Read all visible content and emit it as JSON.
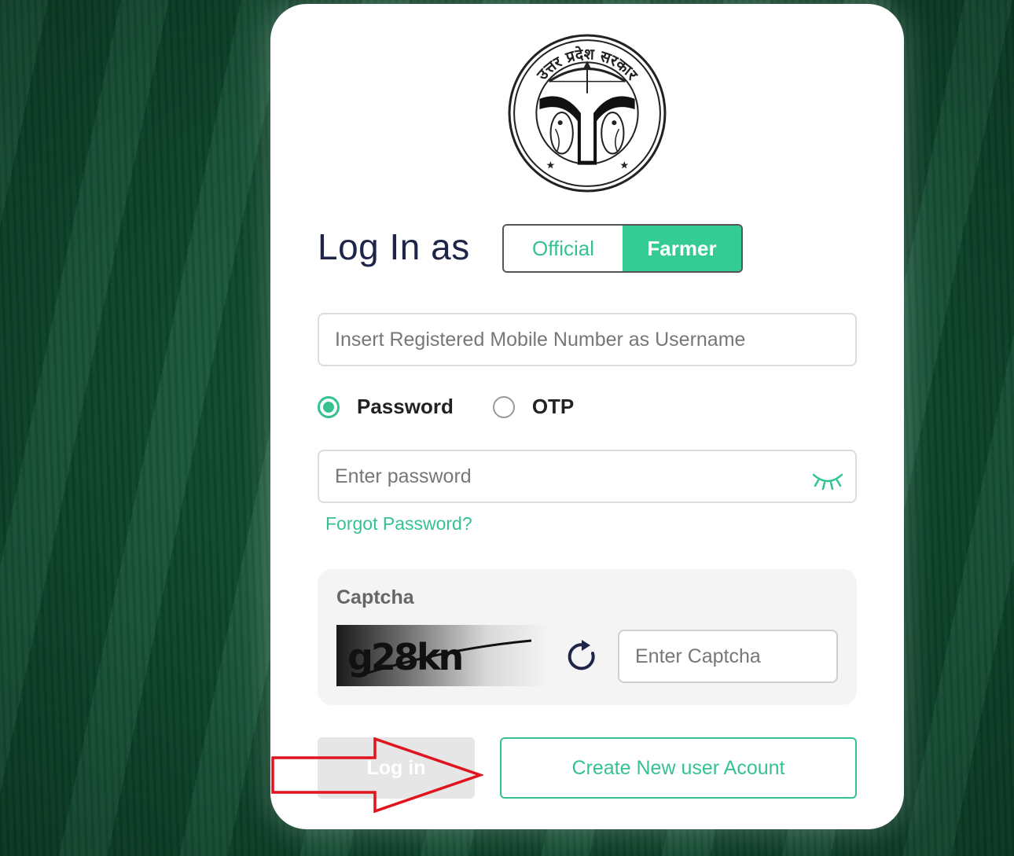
{
  "emblem": {
    "text": "उत्तर प्रदेश सरकार",
    "icon": "up-government-emblem"
  },
  "login": {
    "title": "Log In as",
    "roles": [
      {
        "label": "Official",
        "selected": false
      },
      {
        "label": "Farmer",
        "selected": true
      }
    ]
  },
  "username": {
    "placeholder": "Insert Registered Mobile Number as Username"
  },
  "auth_method": {
    "options": [
      {
        "label": "Password",
        "checked": true
      },
      {
        "label": "OTP",
        "checked": false
      }
    ]
  },
  "password": {
    "placeholder": "Enter password",
    "toggle_icon": "eye-closed-icon"
  },
  "forgot_password": "Forgot Password?",
  "captcha": {
    "title": "Captcha",
    "image_text": "g28kn",
    "refresh_icon": "refresh-icon",
    "placeholder": "Enter Captcha"
  },
  "buttons": {
    "login": "Log in",
    "create_account": "Create New user Acount"
  },
  "colors": {
    "accent": "#34c38f",
    "title": "#1e2548",
    "background": "#0f5133",
    "annotation": "#e0141e"
  }
}
